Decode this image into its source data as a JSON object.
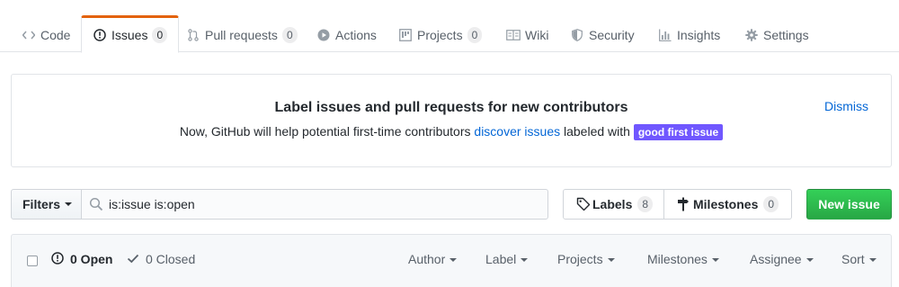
{
  "tabs": [
    {
      "label": "Code",
      "icon": "code-icon"
    },
    {
      "label": "Issues",
      "icon": "issue-opened-icon",
      "count": "0",
      "selected": true
    },
    {
      "label": "Pull requests",
      "icon": "git-pull-request-icon",
      "count": "0"
    },
    {
      "label": "Actions",
      "icon": "play-icon"
    },
    {
      "label": "Projects",
      "icon": "project-icon",
      "count": "0"
    },
    {
      "label": "Wiki",
      "icon": "book-icon"
    },
    {
      "label": "Security",
      "icon": "shield-icon"
    },
    {
      "label": "Insights",
      "icon": "graph-icon"
    },
    {
      "label": "Settings",
      "icon": "gear-icon"
    }
  ],
  "banner": {
    "title": "Label issues and pull requests for new contributors",
    "text_before": "Now, GitHub will help potential first-time contributors ",
    "link": "discover issues",
    "text_after": " labeled with ",
    "label": "good first issue",
    "label_color": "#7057ff",
    "dismiss": "Dismiss"
  },
  "filter_bar": {
    "filters_label": "Filters",
    "search_value": "is:issue is:open",
    "labels_label": "Labels",
    "labels_count": "8",
    "milestones_label": "Milestones",
    "milestones_count": "0",
    "new_issue_label": "New issue"
  },
  "issues_header": {
    "open_label": "0 Open",
    "closed_label": "0 Closed",
    "selects": [
      "Author",
      "Label",
      "Projects",
      "Milestones",
      "Assignee",
      "Sort"
    ]
  },
  "colors": {
    "accent_tab": "#e36209",
    "link": "#0366d6",
    "primary_button": "#28a745"
  }
}
